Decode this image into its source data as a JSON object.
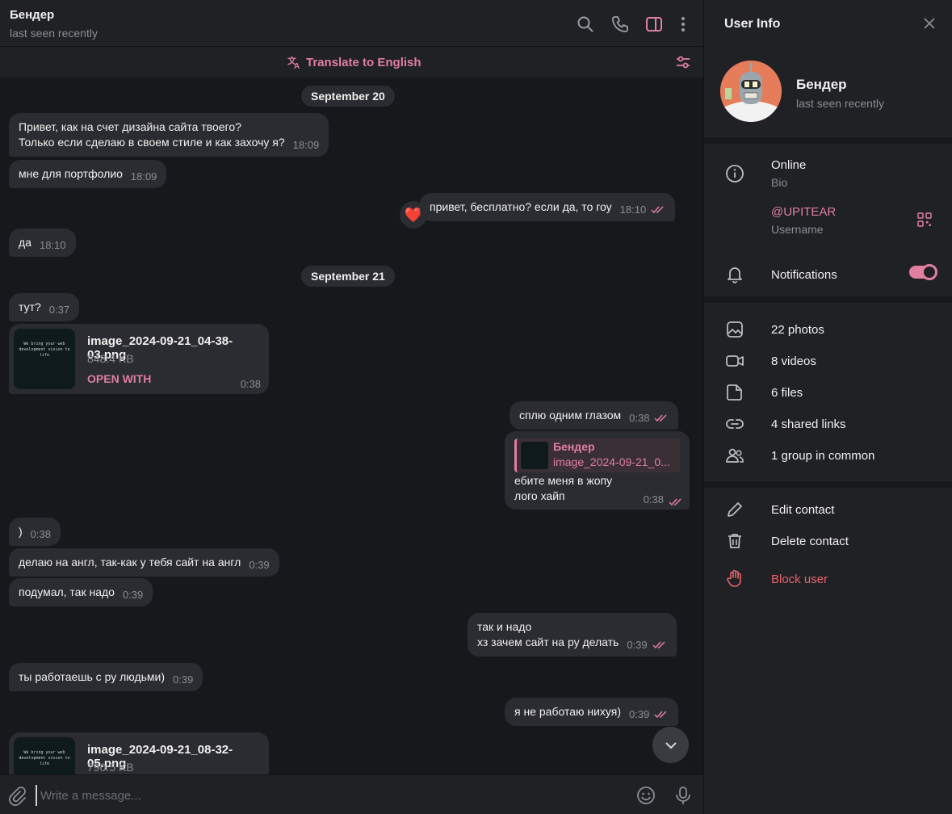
{
  "header": {
    "name": "Бендер",
    "status": "last seen recently",
    "translate_label": "Translate to English"
  },
  "messages": {
    "date1": "September 20",
    "m1_text": "Привет, как на счет дизайна сайта твоего?\nТолько если сделаю в своем стиле и как захочу я?",
    "m1_time": "18:09",
    "m2_text": "мне для портфолио",
    "m2_time": "18:09",
    "m3_text": "привет, бесплатно? если да, то гоу",
    "m3_time": "18:10",
    "m3_reaction": "❤️",
    "m4_text": "да",
    "m4_time": "18:10",
    "date2": "September 21",
    "m5_text": "тут?",
    "m5_time": "0:37",
    "file1": {
      "name": "image_2024-09-21_04-38-03.png",
      "size": "848.4 KB",
      "action": "OPEN WITH",
      "time": "0:38",
      "thumb_text": "We bring your web development vision to life"
    },
    "m6_text": "сплю одним глазом",
    "m6_time": "0:38",
    "reply": {
      "quote_name": "Бендер",
      "quote_text": "image_2024-09-21_0...",
      "text": "ебите меня в жопу\nлого хайп",
      "time": "0:38"
    },
    "m7_text": ")",
    "m7_time": "0:38",
    "m8_text": "делаю на англ, так-как у тебя сайт на англ",
    "m8_time": "0:39",
    "m9_text": "подумал, так надо",
    "m9_time": "0:39",
    "m10_text": "так и надо\nхз зачем сайт на ру делать",
    "m10_time": "0:39",
    "m11_text": "ты работаешь с ру людьми)",
    "m11_time": "0:39",
    "m12_text": "я не работаю нихуя)",
    "m12_time": "0:39",
    "file2": {
      "name": "image_2024-09-21_08-32-05.png",
      "size": "790.5 KB",
      "thumb_text": "We bring your web development vision to life"
    }
  },
  "composer": {
    "placeholder": "Write a message..."
  },
  "user_info": {
    "title": "User Info",
    "name": "Бендер",
    "status": "last seen recently",
    "bio_value": "Online",
    "bio_label": "Bio",
    "username_value": "@UPITEAR",
    "username_label": "Username",
    "notifications_label": "Notifications",
    "notifications_on": true,
    "media": [
      {
        "label": "22 photos",
        "icon": "photo-icon"
      },
      {
        "label": "8 videos",
        "icon": "video-icon"
      },
      {
        "label": "6 files",
        "icon": "file-icon"
      },
      {
        "label": "4 shared links",
        "icon": "link-icon"
      },
      {
        "label": "1 group in common",
        "icon": "group-icon"
      }
    ],
    "edit_contact": "Edit contact",
    "delete_contact": "Delete contact",
    "block_user": "Block user"
  },
  "colors": {
    "accent": "#e07fa0",
    "danger": "#e8636b",
    "background": "#17181c",
    "panel": "#202125",
    "bubble": "#2b2c31"
  }
}
